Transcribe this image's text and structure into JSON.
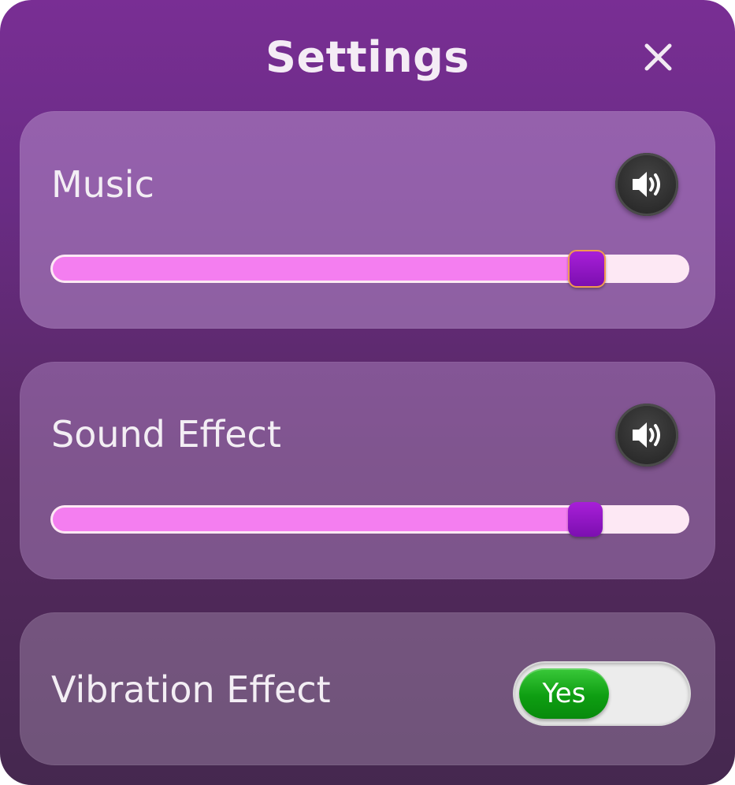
{
  "dialog": {
    "title": "Settings",
    "close_icon": "close-icon"
  },
  "music": {
    "label": "Music",
    "icon": "speaker-icon",
    "volume_fraction": 0.84
  },
  "sound_effect": {
    "label": "Sound Effect",
    "icon": "speaker-icon",
    "volume_fraction": 0.84
  },
  "vibration": {
    "label": "Vibration Effect",
    "toggle_label": "Yes",
    "enabled": true
  },
  "colors": {
    "slider_fill": "#f47ef0",
    "slider_track": "#fde8f4",
    "thumb": "#9015c4",
    "toggle_on": "#0e9e12"
  }
}
